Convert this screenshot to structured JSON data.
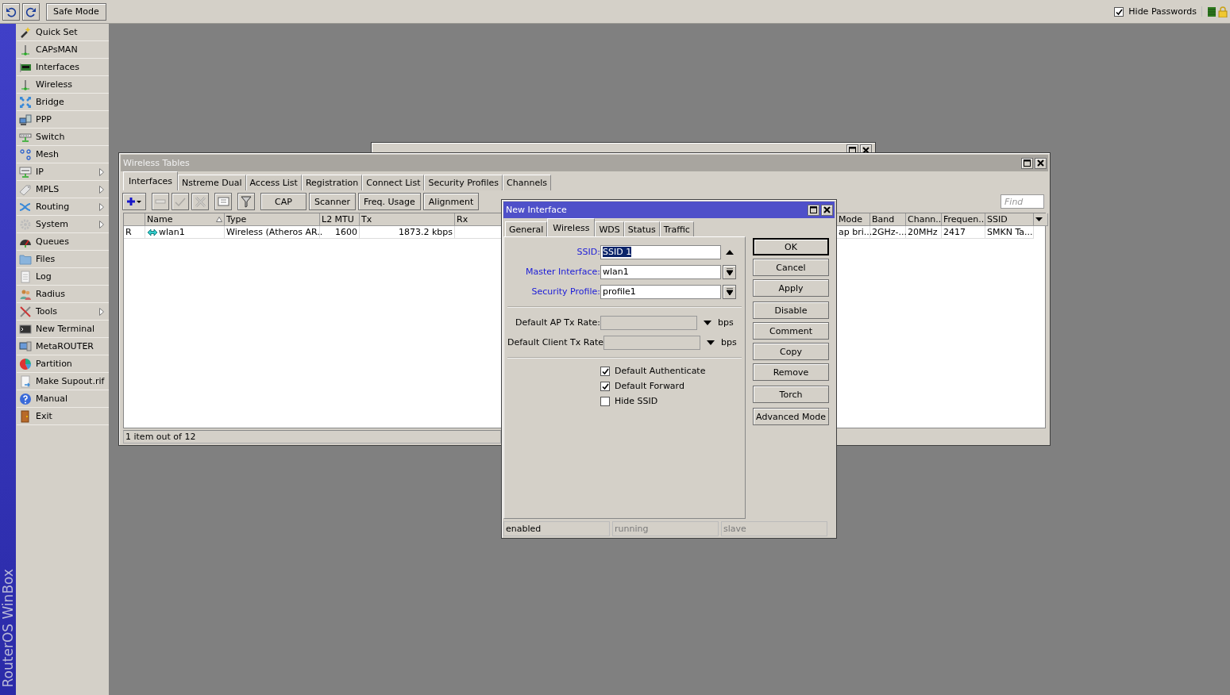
{
  "top_bar": {
    "safe_mode": "Safe Mode",
    "hide_passwords": {
      "label": "Hide Passwords",
      "checked": true
    }
  },
  "sidebar": {
    "brand": "RouterOS WinBox",
    "items": [
      {
        "label": "Quick Set",
        "has_submenu": false
      },
      {
        "label": "CAPsMAN",
        "has_submenu": false
      },
      {
        "label": "Interfaces",
        "has_submenu": false
      },
      {
        "label": "Wireless",
        "has_submenu": false
      },
      {
        "label": "Bridge",
        "has_submenu": false
      },
      {
        "label": "PPP",
        "has_submenu": false
      },
      {
        "label": "Switch",
        "has_submenu": false
      },
      {
        "label": "Mesh",
        "has_submenu": false
      },
      {
        "label": "IP",
        "has_submenu": true
      },
      {
        "label": "MPLS",
        "has_submenu": true
      },
      {
        "label": "Routing",
        "has_submenu": true
      },
      {
        "label": "System",
        "has_submenu": true
      },
      {
        "label": "Queues",
        "has_submenu": false
      },
      {
        "label": "Files",
        "has_submenu": false
      },
      {
        "label": "Log",
        "has_submenu": false
      },
      {
        "label": "Radius",
        "has_submenu": false
      },
      {
        "label": "Tools",
        "has_submenu": true
      },
      {
        "label": "New Terminal",
        "has_submenu": false
      },
      {
        "label": "MetaROUTER",
        "has_submenu": false
      },
      {
        "label": "Partition",
        "has_submenu": false
      },
      {
        "label": "Make Supout.rif",
        "has_submenu": false
      },
      {
        "label": "Manual",
        "has_submenu": false
      },
      {
        "label": "Exit",
        "has_submenu": false
      }
    ]
  },
  "tables_window": {
    "title": "Wireless Tables",
    "tabs": [
      {
        "label": "Interfaces",
        "selected": true
      },
      {
        "label": "Nstreme Dual",
        "selected": false
      },
      {
        "label": "Access List",
        "selected": false
      },
      {
        "label": "Registration",
        "selected": false
      },
      {
        "label": "Connect List",
        "selected": false
      },
      {
        "label": "Security Profiles",
        "selected": false
      },
      {
        "label": "Channels",
        "selected": false
      }
    ],
    "tools": [
      {
        "disabled": false
      },
      {
        "disabled": true
      },
      {
        "disabled": true
      },
      {
        "disabled": true
      },
      {
        "disabled": false
      },
      {
        "disabled": false
      }
    ],
    "buttons": [
      "CAP",
      "Scanner",
      "Freq. Usage",
      "Alignment"
    ],
    "find": {
      "placeholder": "Find"
    },
    "table": {
      "columns": [
        {},
        {
          "label": "Name",
          "sorted": true
        },
        {
          "label": "Type"
        },
        {
          "label": "L2 MTU"
        },
        {
          "label": "Tx"
        },
        {
          "label": "Rx"
        },
        {
          "label": "Mode"
        },
        {
          "label": "Band"
        },
        {
          "label": "Chann.."
        },
        {
          "label": "Frequen.."
        },
        {
          "label": "SSID"
        }
      ],
      "rows": [
        {
          "cells": [
            "R",
            "wlan1",
            "Wireless (Atheros AR..",
            "1600",
            "1873.2 kbps",
            null,
            "ap bri...",
            "2GHz-...",
            "20MHz",
            "2417",
            "SMKN Ta..."
          ]
        }
      ]
    },
    "status": "1 item out of 12"
  },
  "dialog": {
    "title": "New Interface",
    "tabs": [
      {
        "label": "General",
        "selected": false
      },
      {
        "label": "Wireless",
        "selected": true
      },
      {
        "label": "WDS",
        "selected": false
      },
      {
        "label": "Status",
        "selected": false
      },
      {
        "label": "Traffic",
        "selected": false
      }
    ],
    "sections": [
      [
        {
          "label": "SSID:",
          "value": "SSID 1",
          "kind": "text_arrow",
          "required": true,
          "value_selected": true
        },
        {
          "label": "Master Interface:",
          "value": "wlan1",
          "kind": "combo",
          "required": true,
          "value_selected": false
        },
        {
          "label": "Security Profile:",
          "value": "profile1",
          "kind": "combo",
          "required": true,
          "value_selected": false
        }
      ],
      [
        {
          "label": "Default AP Tx Rate:",
          "kind": "rate",
          "unit": "bps",
          "required": false
        },
        {
          "label": "Default Client Tx Rate",
          "kind": "rate",
          "unit": "bps",
          "required": false
        }
      ]
    ],
    "checkboxes": [
      {
        "label": "Default Authenticate",
        "checked": true
      },
      {
        "label": "Default Forward",
        "checked": true
      },
      {
        "label": "Hide SSID",
        "checked": false
      }
    ],
    "button_groups": [
      [
        {
          "label": "OK",
          "default": true
        },
        {
          "label": "Cancel",
          "default": false
        },
        {
          "label": "Apply",
          "default": false
        }
      ],
      [
        {
          "label": "Disable",
          "default": false
        },
        {
          "label": "Comment",
          "default": false
        },
        {
          "label": "Copy",
          "default": false
        },
        {
          "label": "Remove",
          "default": false
        }
      ],
      [
        {
          "label": "Torch",
          "default": false
        }
      ],
      [
        {
          "label": "Advanced Mode",
          "default": false
        }
      ]
    ],
    "status": [
      {
        "label": "enabled",
        "active": true
      },
      {
        "label": "running",
        "active": false
      },
      {
        "label": "slave",
        "active": false
      }
    ]
  }
}
